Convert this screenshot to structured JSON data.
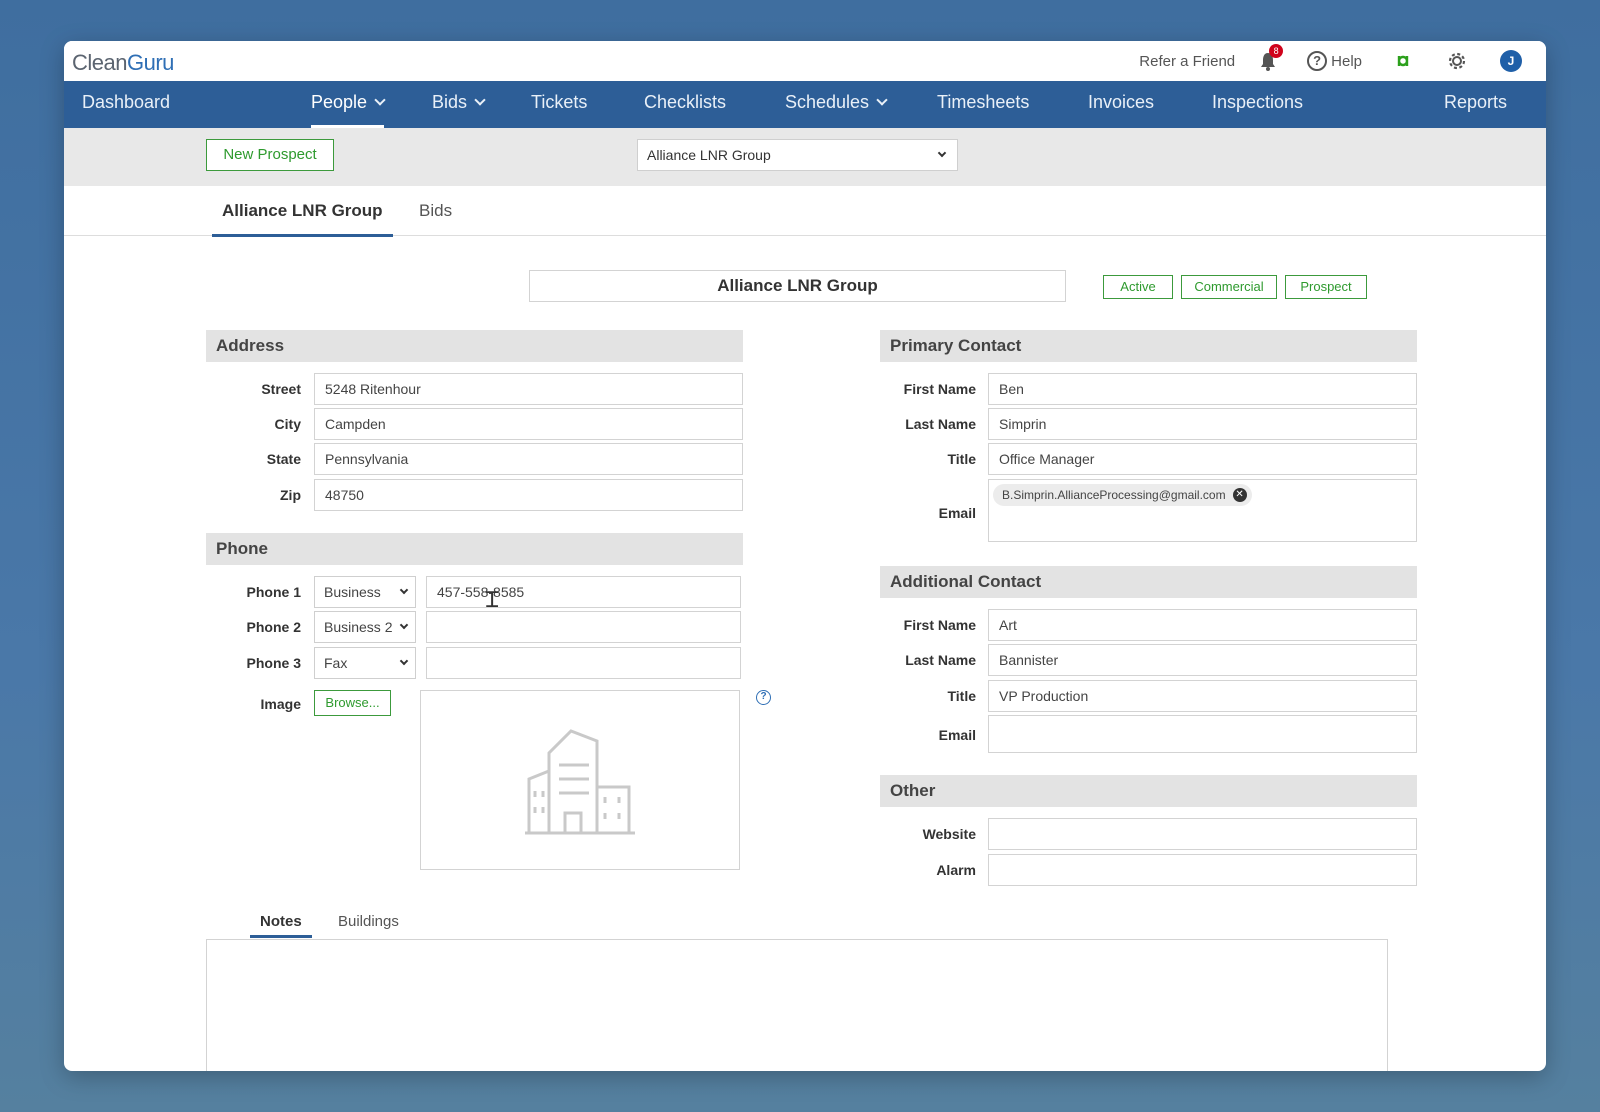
{
  "app": {
    "logo_part1": "Clean",
    "logo_part2": "Guru"
  },
  "topbar": {
    "refer_label": "Refer a Friend",
    "notification_count": "8",
    "help_label": "Help",
    "avatar_initial": "J"
  },
  "nav": {
    "dashboard": "Dashboard",
    "people": "People",
    "bids": "Bids",
    "tickets": "Tickets",
    "checklists": "Checklists",
    "schedules": "Schedules",
    "timesheets": "Timesheets",
    "invoices": "Invoices",
    "inspections": "Inspections",
    "reports": "Reports",
    "active_item": "People"
  },
  "toolbar": {
    "new_prospect_label": "New Prospect",
    "company_selected": "Alliance LNR Group"
  },
  "tabs": {
    "company": "Alliance LNR Group",
    "bids": "Bids"
  },
  "company": {
    "name": "Alliance LNR Group",
    "tags": [
      "Active",
      "Commercial",
      "Prospect"
    ]
  },
  "address": {
    "header": "Address",
    "street_label": "Street",
    "street": "5248 Ritenhour",
    "city_label": "City",
    "city": "Campden",
    "state_label": "State",
    "state": "Pennsylvania",
    "zip_label": "Zip",
    "zip": "48750"
  },
  "phone": {
    "header": "Phone",
    "phone1_label": "Phone 1",
    "phone1_type": "Business",
    "phone1_value": "457-558-8585",
    "phone2_label": "Phone 2",
    "phone2_type": "Business 2",
    "phone2_value": "",
    "phone3_label": "Phone 3",
    "phone3_type": "Fax",
    "phone3_value": "",
    "image_label": "Image",
    "browse_label": "Browse...",
    "info_icon": "?"
  },
  "primary_contact": {
    "header": "Primary Contact",
    "first_name_label": "First Name",
    "first_name": "Ben",
    "last_name_label": "Last Name",
    "last_name": "Simprin",
    "title_label": "Title",
    "title": "Office Manager",
    "email_label": "Email",
    "email": "B.Simprin.AllianceProcessing@gmail.com"
  },
  "additional_contact": {
    "header": "Additional Contact",
    "first_name_label": "First Name",
    "first_name": "Art",
    "last_name_label": "Last Name",
    "last_name": "Bannister",
    "title_label": "Title",
    "title": "VP Production",
    "email_label": "Email",
    "email": ""
  },
  "other": {
    "header": "Other",
    "website_label": "Website",
    "website": "",
    "alarm_label": "Alarm",
    "alarm": ""
  },
  "bottom_tabs": {
    "notes": "Notes",
    "buildings": "Buildings"
  },
  "colors": {
    "nav_bg": "#2d5e97",
    "accent_green": "#2e9a2e",
    "badge_red": "#d0021b"
  },
  "icons": [
    "bell-icon",
    "help-icon",
    "quickbooks-icon",
    "gear-icon",
    "building-icon",
    "info-icon",
    "remove-chip-icon",
    "text-cursor-icon"
  ]
}
